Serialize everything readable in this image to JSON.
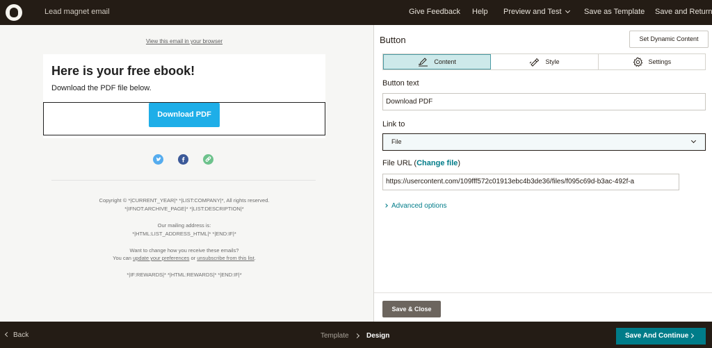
{
  "topbar": {
    "title": "Lead magnet email",
    "nav": {
      "feedback": "Give Feedback",
      "help": "Help",
      "preview": "Preview and Test",
      "save_template": "Save as Template",
      "save_return": "Save and Return"
    }
  },
  "preview": {
    "view_link": "View this email in your browser",
    "heading": "Here is your free ebook!",
    "subtext": "Download the PDF file below.",
    "button_label": "Download PDF",
    "social_icons": [
      "twitter-icon",
      "facebook-icon",
      "link-icon"
    ],
    "footer": {
      "copyright_line1": "Copyright © *|CURRENT_YEAR|* *|LIST:COMPANY|*, All rights reserved.",
      "copyright_line2": "*|IFNOT:ARCHIVE_PAGE|* *|LIST:DESCRIPTION|*",
      "mailing_heading": "Our mailing address is:",
      "mailing_value": "*|HTML:LIST_ADDRESS_HTML|* *|END:IF|*",
      "change_line": "Want to change how you receive these emails?",
      "can_prefix": "You can ",
      "update_link": "update your preferences",
      "or_text": " or ",
      "unsubscribe_link": "unsubscribe from this list",
      "period": ".",
      "rewards": "*|IF:REWARDS|* *|HTML:REWARDS|* *|END:IF|*"
    }
  },
  "panel": {
    "title": "Button",
    "dynamic_button": "Set Dynamic Content",
    "tabs": [
      {
        "label": "Content",
        "icon": "pencil-icon",
        "active": true
      },
      {
        "label": "Style",
        "icon": "paint-icon",
        "active": false
      },
      {
        "label": "Settings",
        "icon": "gear-icon",
        "active": false
      }
    ],
    "button_text_label": "Button text",
    "button_text_value": "Download PDF",
    "link_to_label": "Link to",
    "link_to_value": "File",
    "file_url_label_prefix": "File URL (",
    "change_file": "Change file",
    "file_url_label_suffix": ")",
    "file_url_value": "https://usercontent.com/109fff572c01913ebc4b3de36/files/f095c69d-b3ac-492f-a",
    "advanced_options": "Advanced options",
    "save_close": "Save & Close"
  },
  "bottombar": {
    "back": "Back",
    "crumb_template": "Template",
    "crumb_design": "Design",
    "continue": "Save And Continue"
  },
  "colors": {
    "topbar_bg": "#241c15",
    "accent_teal": "#007c89",
    "download_button": "#1eaee8",
    "active_tab_bg": "#cde9ea",
    "save_close_bg": "#6c655e"
  }
}
